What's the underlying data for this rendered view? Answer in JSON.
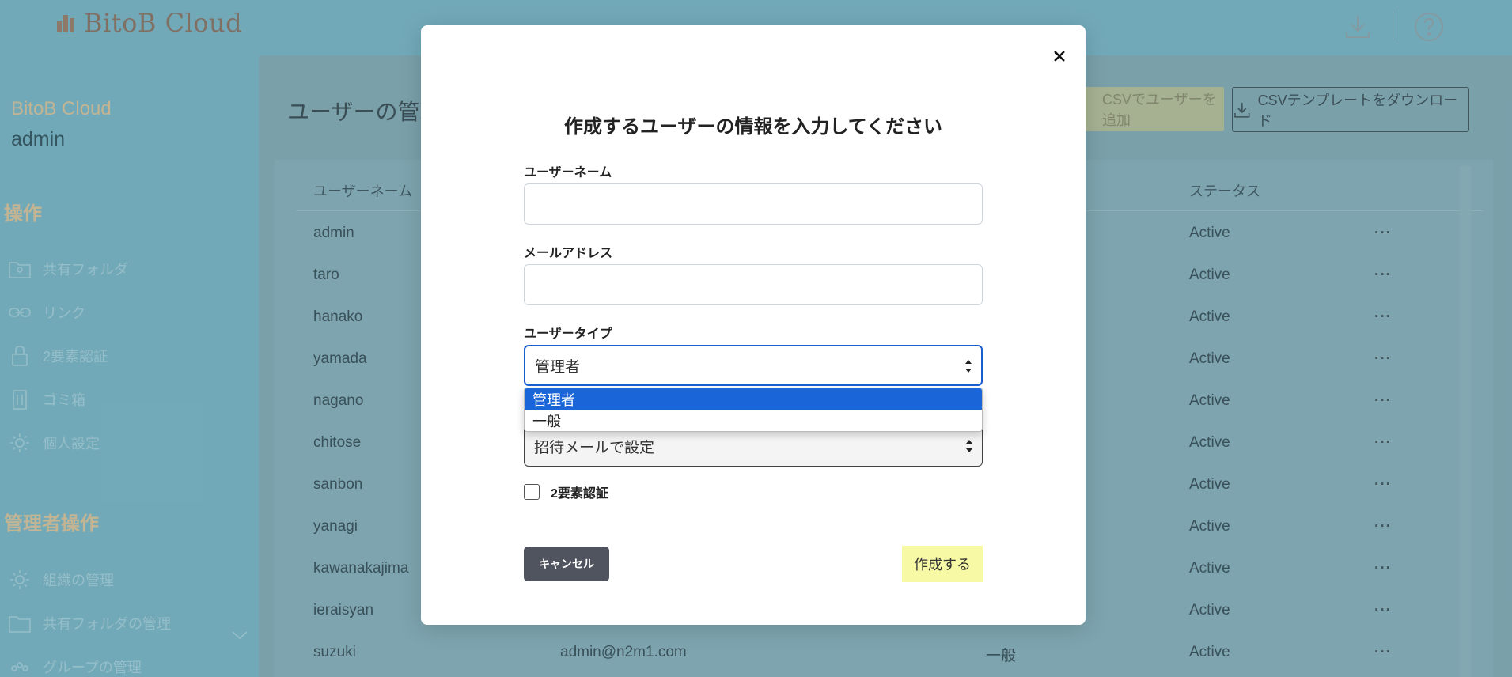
{
  "app": {
    "logo_text": "BitoB Cloud",
    "accent_color": "#7ab6c6",
    "brand_color": "#d7c39b"
  },
  "topbar": {
    "icons": [
      "download-icon",
      "help-icon"
    ]
  },
  "sidebar": {
    "brand": "BitoB Cloud",
    "user": "admin",
    "section_ops": "操作",
    "items": [
      {
        "label": "共有フォルダ",
        "icon": "shared-folder-icon"
      },
      {
        "label": "リンク",
        "icon": "link-icon"
      },
      {
        "label": "2要素認証",
        "icon": "lock-icon"
      },
      {
        "label": "ゴミ箱",
        "icon": "trash-icon"
      },
      {
        "label": "個人設定",
        "icon": "gear-icon"
      }
    ],
    "section_admin": "管理者操作",
    "admin_items": [
      {
        "label": "組織の管理",
        "icon": "gear-icon"
      },
      {
        "label": "共有フォルダの管理",
        "icon": "folder-icon"
      },
      {
        "label": "グループの管理",
        "icon": "group-icon"
      }
    ]
  },
  "main": {
    "title": "ユーザーの管理",
    "csv_add_button": "CSVでユーザーを追加",
    "csv_template_button": "CSVテンプレートをダウンロード",
    "table": {
      "columns": [
        "ユーザーネーム",
        "ステータス"
      ],
      "rows": [
        {
          "username": "admin",
          "email": "",
          "type": "",
          "status": "Active"
        },
        {
          "username": "taro",
          "email": "",
          "type": "",
          "status": "Active"
        },
        {
          "username": "hanako",
          "email": "",
          "type": "",
          "status": "Active"
        },
        {
          "username": "yamada",
          "email": "",
          "type": "",
          "status": "Active"
        },
        {
          "username": "nagano",
          "email": "",
          "type": "",
          "status": "Active"
        },
        {
          "username": "chitose",
          "email": "",
          "type": "",
          "status": "Active"
        },
        {
          "username": "sanbon",
          "email": "",
          "type": "",
          "status": "Active"
        },
        {
          "username": "yanagi",
          "email": "",
          "type": "",
          "status": "Active"
        },
        {
          "username": "kawanakajima",
          "email": "",
          "type": "",
          "status": "Active"
        },
        {
          "username": "ieraisyan",
          "email": "",
          "type": "",
          "status": "Active"
        },
        {
          "username": "suzuki",
          "email": "admin@n2m1.com",
          "type": "一般",
          "status": "Active"
        }
      ],
      "row_menu": "···"
    }
  },
  "modal": {
    "title": "作成するユーザーの情報を入力してください",
    "username_label": "ユーザーネーム",
    "username_value": "",
    "email_label": "メールアドレス",
    "email_value": "",
    "usertype_label": "ユーザータイプ",
    "usertype_selected": "管理者",
    "usertype_options": [
      "管理者",
      "一般"
    ],
    "password_selected": "招待メールで設定",
    "twofa_label": "2要素認証",
    "twofa_checked": false,
    "cancel_label": "キャンセル",
    "create_label": "作成する"
  }
}
